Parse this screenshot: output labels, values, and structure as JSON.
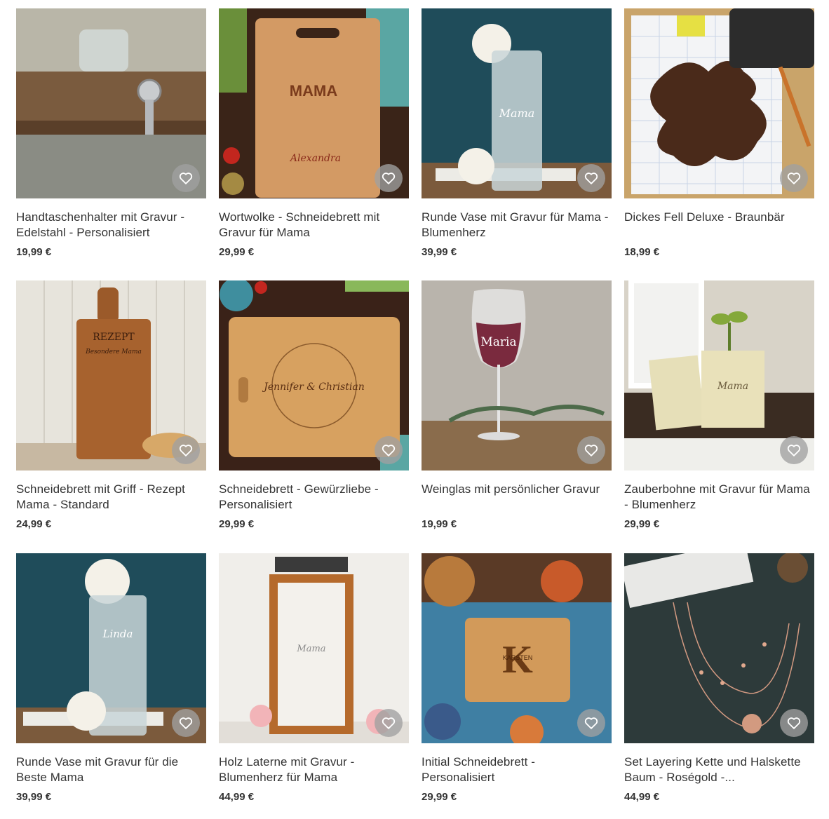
{
  "favorite_icon": "heart-icon",
  "products": [
    {
      "title": "Handtaschenhalter mit Gravur - Edelstahl - Personalisiert",
      "price": "19,99 €"
    },
    {
      "title": "Wortwolke - Schneidebrett mit Gravur für Mama",
      "price": "29,99 €",
      "image_text": [
        "MAMA",
        "Alexandra"
      ]
    },
    {
      "title": "Runde Vase mit Gravur für Mama - Blumenherz",
      "price": "39,99 €",
      "image_text": [
        "Mama"
      ]
    },
    {
      "title": "Dickes Fell Deluxe - Braunbär",
      "price": "18,99 €"
    },
    {
      "title": "Schneidebrett mit Griff - Rezept Mama - Standard",
      "price": "24,99 €",
      "image_text": [
        "REZEPT",
        "Besondere Mama"
      ]
    },
    {
      "title": "Schneidebrett - Gewürzliebe - Personalisiert",
      "price": "29,99 €",
      "image_text": [
        "Jennifer & Christian"
      ]
    },
    {
      "title": "Weinglas mit persönlicher Gravur",
      "price": "19,99 €",
      "image_text": [
        "Maria"
      ]
    },
    {
      "title": "Zauberbohne mit Gravur für Mama - Blumenherz",
      "price": "29,99 €",
      "image_text": [
        "Mama"
      ]
    },
    {
      "title": "Runde Vase mit Gravur für die Beste Mama",
      "price": "39,99 €",
      "image_text": [
        "Linda"
      ]
    },
    {
      "title": "Holz Laterne mit Gravur - Blumenherz für Mama",
      "price": "44,99 €",
      "image_text": [
        "Mama"
      ]
    },
    {
      "title": "Initial Schneidebrett - Personalisiert",
      "price": "29,99 €",
      "image_text": [
        "K",
        "KARSTEN"
      ]
    },
    {
      "title": "Set Layering Kette und Halskette Baum - Roségold -...",
      "price": "44,99 €"
    }
  ]
}
